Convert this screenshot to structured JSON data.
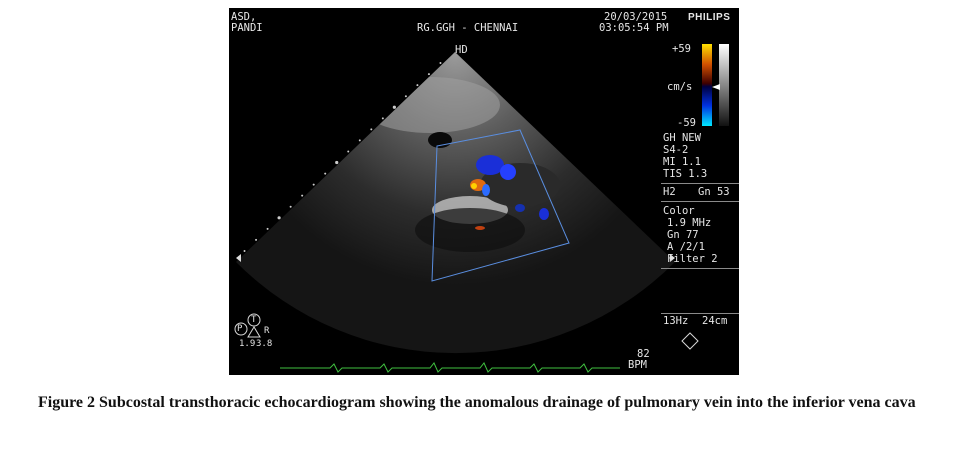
{
  "header": {
    "patient_line1": "ASD,",
    "patient_line2": "PANDI",
    "institution": "RG.GGH - CHENNAI",
    "date": "20/03/2015",
    "time": "03:05:54 PM",
    "brand": "PHILIPS"
  },
  "image": {
    "hd_label": "HD"
  },
  "color_scale": {
    "max": "+59",
    "unit": "cm/s",
    "min": "-59",
    "colors": {
      "top": "#ffe000",
      "upper_mid": "#b00000",
      "lower_mid": "#0020d0",
      "bottom": "#00e8ff"
    }
  },
  "settings": {
    "preset": "GH NEW",
    "probe": "S4-2",
    "mi": "MI 1.1",
    "tis": "TIS 1.3",
    "harmonic": "H2",
    "gain": "Gn 53",
    "color_title": "Color",
    "freq": "1.9 MHz",
    "color_gain": "Gn 77",
    "assignment": "A /2/1",
    "filter": "Filter 2",
    "frame_rate": "13Hz",
    "depth": "24cm"
  },
  "probe_orientation": {
    "p": "P",
    "t": "T",
    "r": "R",
    "left_value": "1.9",
    "right_value": "3.8"
  },
  "ecg": {
    "heart_rate": "82",
    "unit": "BPM",
    "trace_color": "#3fbf3f"
  },
  "caption": "Figure 2 Subcostal transthoracic echocardiogram showing the anomalous drainage of pulmonary vein into the inferior vena cava"
}
